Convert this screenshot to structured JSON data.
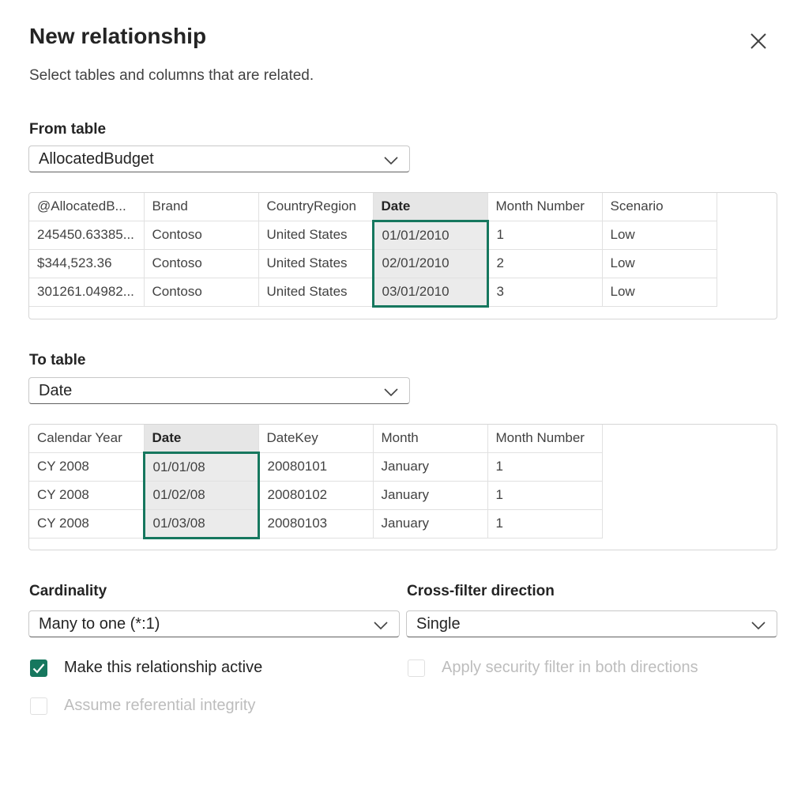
{
  "dialog": {
    "title": "New relationship",
    "subtitle": "Select tables and columns that are related."
  },
  "from": {
    "label": "From table",
    "selected": "AllocatedBudget",
    "headers": [
      "@AllocatedB...",
      "Brand",
      "CountryRegion",
      "Date",
      "Month Number",
      "Scenario"
    ],
    "selected_column": "Date",
    "rows": [
      [
        "245450.63385...",
        "Contoso",
        "United States",
        "01/01/2010",
        "1",
        "Low"
      ],
      [
        "$344,523.36",
        "Contoso",
        "United States",
        "02/01/2010",
        "2",
        "Low"
      ],
      [
        "301261.04982...",
        "Contoso",
        "United States",
        "03/01/2010",
        "3",
        "Low"
      ]
    ]
  },
  "to": {
    "label": "To table",
    "selected": "Date",
    "headers": [
      "Calendar Year",
      "Date",
      "DateKey",
      "Month",
      "Month Number"
    ],
    "selected_column": "Date",
    "rows": [
      [
        "CY 2008",
        "01/01/08",
        "20080101",
        "January",
        "1"
      ],
      [
        "CY 2008",
        "01/02/08",
        "20080102",
        "January",
        "1"
      ],
      [
        "CY 2008",
        "01/03/08",
        "20080103",
        "January",
        "1"
      ]
    ]
  },
  "cardinality": {
    "label": "Cardinality",
    "selected": "Many to one (*:1)"
  },
  "cross_filter": {
    "label": "Cross-filter direction",
    "selected": "Single"
  },
  "options": {
    "active": {
      "label": "Make this relationship active",
      "checked": true,
      "enabled": true
    },
    "security": {
      "label": "Apply security filter in both directions",
      "checked": false,
      "enabled": false
    },
    "referential": {
      "label": "Assume referential integrity",
      "checked": false,
      "enabled": false
    }
  },
  "colors": {
    "accent": "#16775e",
    "selected_column_bg": "#ebebeb",
    "disabled_text": "#bdbdbd"
  },
  "icons": {
    "close": "close-icon",
    "dropdown": "chevron-down-icon",
    "check": "checkmark-icon"
  }
}
